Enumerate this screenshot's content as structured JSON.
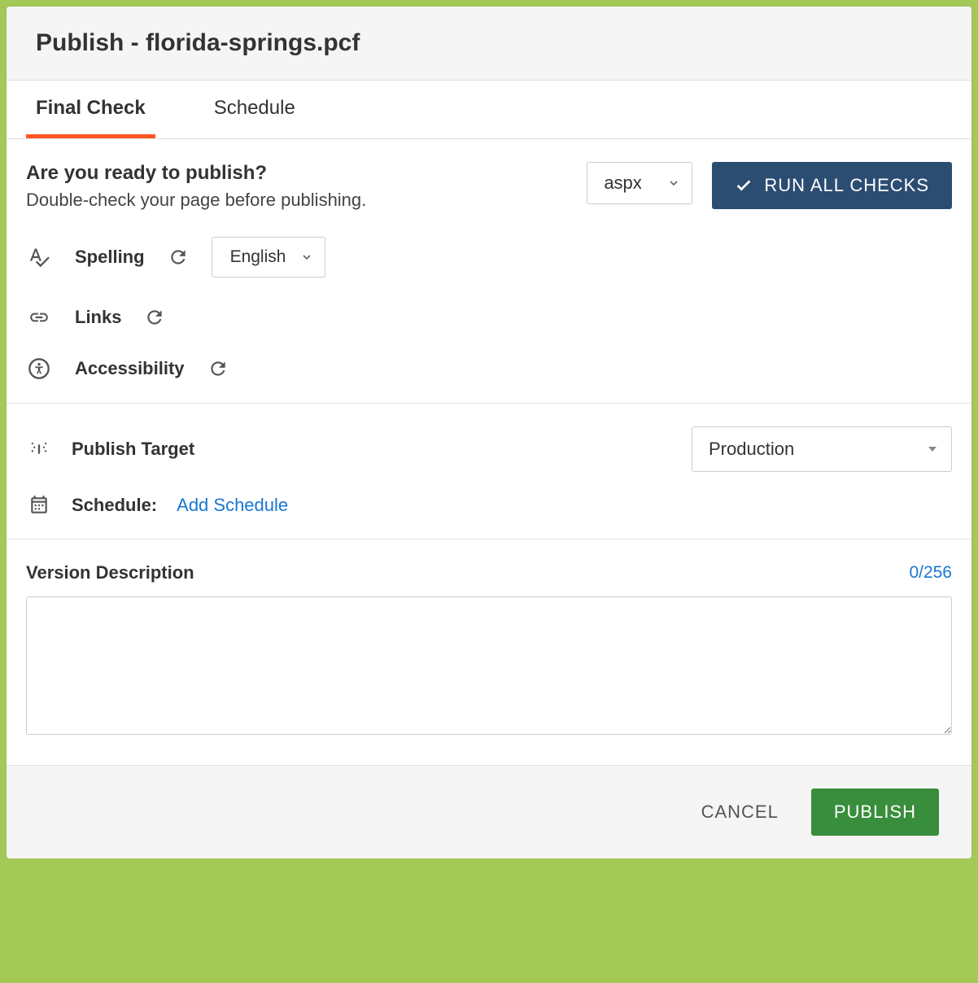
{
  "header": {
    "title": "Publish - florida-springs.pcf"
  },
  "tabs": [
    {
      "label": "Final Check",
      "active": true
    },
    {
      "label": "Schedule",
      "active": false
    }
  ],
  "ready": {
    "title": "Are you ready to publish?",
    "subtitle": "Double-check your page before publishing.",
    "format_select": "aspx",
    "run_all_label": "RUN ALL CHECKS"
  },
  "checks": {
    "spelling": {
      "label": "Spelling",
      "language_select": "English"
    },
    "links": {
      "label": "Links"
    },
    "accessibility": {
      "label": "Accessibility"
    }
  },
  "settings": {
    "publish_target": {
      "label": "Publish Target",
      "value": "Production"
    },
    "schedule": {
      "label": "Schedule:",
      "link": "Add Schedule"
    }
  },
  "description": {
    "label": "Version Description",
    "counter": "0/256",
    "value": ""
  },
  "footer": {
    "cancel": "CANCEL",
    "publish": "PUBLISH"
  }
}
